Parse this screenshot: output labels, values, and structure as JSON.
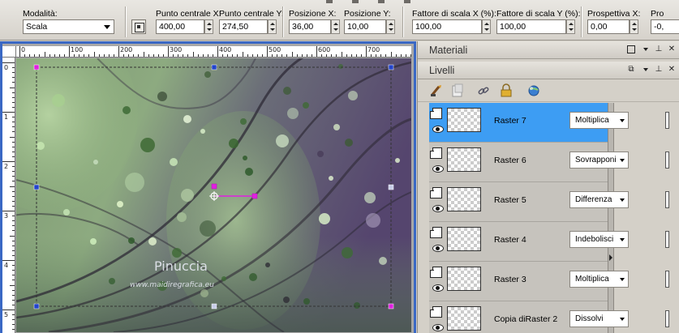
{
  "toolbar": {
    "mode_label": "Modalità:",
    "mode_value": "Scala",
    "center_x_label": "Punto centrale X:",
    "center_x_value": "400,00",
    "center_y_label": "Punto centrale Y:",
    "center_y_value": "274,50",
    "pos_x_label": "Posizione X:",
    "pos_x_value": "36,00",
    "pos_y_label": "Posizione Y:",
    "pos_y_value": "10,00",
    "scale_x_label": "Fattore di scala X (%):",
    "scale_x_value": "100,00",
    "scale_y_label": "Fattore di scala Y (%):",
    "scale_y_value": "100,00",
    "perspective_x_label": "Prospettiva X:",
    "perspective_x_value": "0,00",
    "perspective_y_label": "Pro",
    "perspective_y_value": "-0,"
  },
  "rulers": {
    "top": [
      "0",
      "100",
      "200",
      "300",
      "400",
      "500",
      "600",
      "700"
    ],
    "left": [
      "0",
      "1",
      "2",
      "3",
      "4",
      "5"
    ]
  },
  "canvas": {
    "watermark_title": "Pinuccia",
    "watermark_url": "www.maidiregrafica.eu"
  },
  "materials_panel": {
    "title": "Materiali"
  },
  "layers_panel": {
    "title": "Livelli",
    "layers": [
      {
        "name": "Raster 7",
        "blend": "Moltiplica",
        "selected": true
      },
      {
        "name": "Raster 6",
        "blend": "Sovrapponi",
        "selected": false
      },
      {
        "name": "Raster 5",
        "blend": "Differenza",
        "selected": false
      },
      {
        "name": "Raster 4",
        "blend": "Indebolisci",
        "selected": false
      },
      {
        "name": "Raster 3",
        "blend": "Moltiplica",
        "selected": false
      },
      {
        "name": "Copia diRaster 2",
        "blend": "Dissolvi",
        "selected": false
      }
    ]
  },
  "colors": {
    "frame_blue": "#3a68c4",
    "selected_layer": "#3d9df3",
    "bokeh_green": "#8fb87e",
    "bokeh_purple": "#5d4d78",
    "handle_magenta": "#e020e0"
  }
}
